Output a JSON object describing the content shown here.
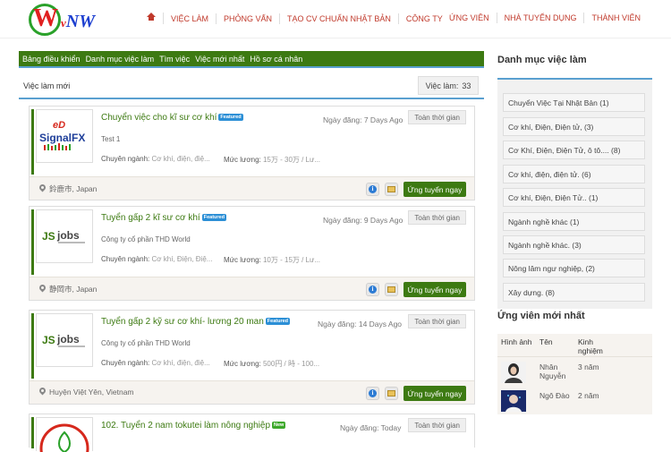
{
  "header": {
    "logo": {
      "letter_w": "W",
      "letters_rest_v": "v",
      "letters_rest_n": "N",
      "letters_rest_w": "W"
    },
    "nav_left": [
      "VIỆC LÀM",
      "PHỎNG VẤN",
      "TẠO CV CHUẨN NHẬT BẢN",
      "CÔNG TY"
    ],
    "nav_right": [
      "ỨNG VIÊN",
      "NHÀ TUYỂN DỤNG",
      "THÀNH VIÊN"
    ],
    "accent_color": "#c0392b"
  },
  "toolbar": {
    "items": [
      "Bảng điều khiển",
      "Danh mục việc làm",
      "Tìm việc",
      "Việc mới nhất",
      "Hồ sơ cá nhân"
    ],
    "color": "#3d7a12"
  },
  "jobs": {
    "title": "Việc làm mới",
    "count_label": "Việc làm:",
    "count": "33",
    "list": [
      {
        "title": "Chuyển việc cho kĩ sư cơ khí",
        "badge": "Featured",
        "date": "Ngày đăng: 7 Days Ago",
        "type": "Toàn thời gian",
        "company": "Test 1",
        "industry_label": "Chuyên ngành:",
        "industry": "Cơ khí, điện, điệ...",
        "salary_label": "Mức lương:",
        "salary": "15万 - 30万 / Lư...",
        "location": "鈴鹿市, Japan",
        "apply": "Ứng tuyển ngay",
        "logo": "SignalFX"
      },
      {
        "title": "Tuyển gấp 2 kĩ sư cơ khí",
        "badge": "Featured",
        "date": "Ngày đăng: 9 Days Ago",
        "type": "Toàn thời gian",
        "company": "Công ty cổ phần THD World",
        "industry_label": "Chuyên ngành:",
        "industry": "Cơ khí, Điện, Điệ...",
        "salary_label": "Mức lương:",
        "salary": "10万 - 15万 / Lư...",
        "location": "静岡市, Japan",
        "apply": "Ứng tuyển ngay",
        "logo": "jobs"
      },
      {
        "title": "Tuyển gấp 2 kỹ sư cơ khí- lương 20 man",
        "badge": "Featured",
        "date": "Ngày đăng: 14 Days Ago",
        "type": "Toàn thời gian",
        "company": "Công ty cổ phần THD World",
        "industry_label": "Chuyên ngành:",
        "industry": "Cơ khí, điện, điệ...",
        "salary_label": "Mức lương:",
        "salary": "500円 / 時 - 100...",
        "location": "Huyện Việt Yên, Vietnam",
        "apply": "Ứng tuyển ngay",
        "logo": "jobs"
      },
      {
        "title": "102. Tuyển 2 nam tokutei làm nông nghiệp",
        "badge": "New",
        "date": "Ngày đăng: Today",
        "type": "Toàn thời gian",
        "company": "",
        "industry_label": "",
        "industry": "",
        "salary_label": "",
        "salary": "",
        "location": "",
        "apply": "",
        "logo": "circle"
      }
    ]
  },
  "sidebar": {
    "categories_title": "Danh mục việc làm",
    "categories": [
      "Chuyển Việc Tại Nhật Bản (1)",
      "Cơ khí, Điện, Điện tử, (3)",
      "Cơ Khí, Điện, Điện Tử, ô tô.... (8)",
      "Cơ khí, điện, điện tử. (6)",
      "Cơ khí, Điện, Điện Tử.. (1)",
      "Ngành nghề khác (1)",
      "Ngành nghề khác. (3)",
      "Nông lâm ngư nghiệp, (2)",
      "Xây dựng. (8)"
    ],
    "candidates_title": "Ứng viên mới nhất",
    "cand_head": {
      "image": "Hình ảnh",
      "name": "Tên",
      "exp": "Kinh nghiệm"
    },
    "candidates": [
      {
        "name": "Nhân Nguyễn",
        "exp": "3 năm"
      },
      {
        "name": "Ngô Đào",
        "exp": "2 năm"
      }
    ]
  }
}
